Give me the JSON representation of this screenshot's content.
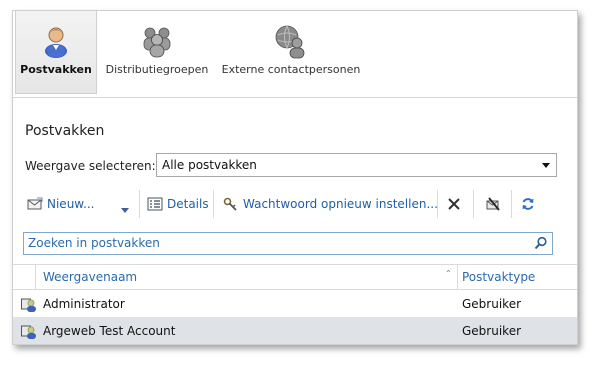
{
  "ribbon": {
    "items": [
      {
        "label": "Postvakken",
        "icon": "user-icon",
        "active": true
      },
      {
        "label": "Distributiegroepen",
        "icon": "group-icon",
        "active": false
      },
      {
        "label": "Externe contactpersonen",
        "icon": "contact-globe-icon",
        "active": false
      }
    ]
  },
  "main": {
    "title": "Postvakken",
    "view_label": "Weergave selecteren:",
    "view_value": "Alle postvakken"
  },
  "toolbar": {
    "new_label": "Nieuw...",
    "details_label": "Details",
    "reset_password_label": "Wachtwoord opnieuw instellen...",
    "icons": [
      "mail-new-icon",
      "dropdown-arrow-icon",
      "details-icon",
      "key-tool-icon",
      "delete-icon",
      "disable-icon",
      "refresh-icon"
    ]
  },
  "search": {
    "placeholder": "Zoeken in postvakken"
  },
  "table": {
    "columns": [
      "Weergavenaam",
      "Postvaktype"
    ],
    "rows": [
      {
        "name": "Administrator",
        "type": "Gebruiker",
        "selected": false
      },
      {
        "name": "Argeweb Test Account",
        "type": "Gebruiker",
        "selected": true
      }
    ]
  },
  "colors": {
    "link": "#1f5fa8",
    "selected_row": "#dfe3e8",
    "search_border": "#7fa7cf"
  }
}
